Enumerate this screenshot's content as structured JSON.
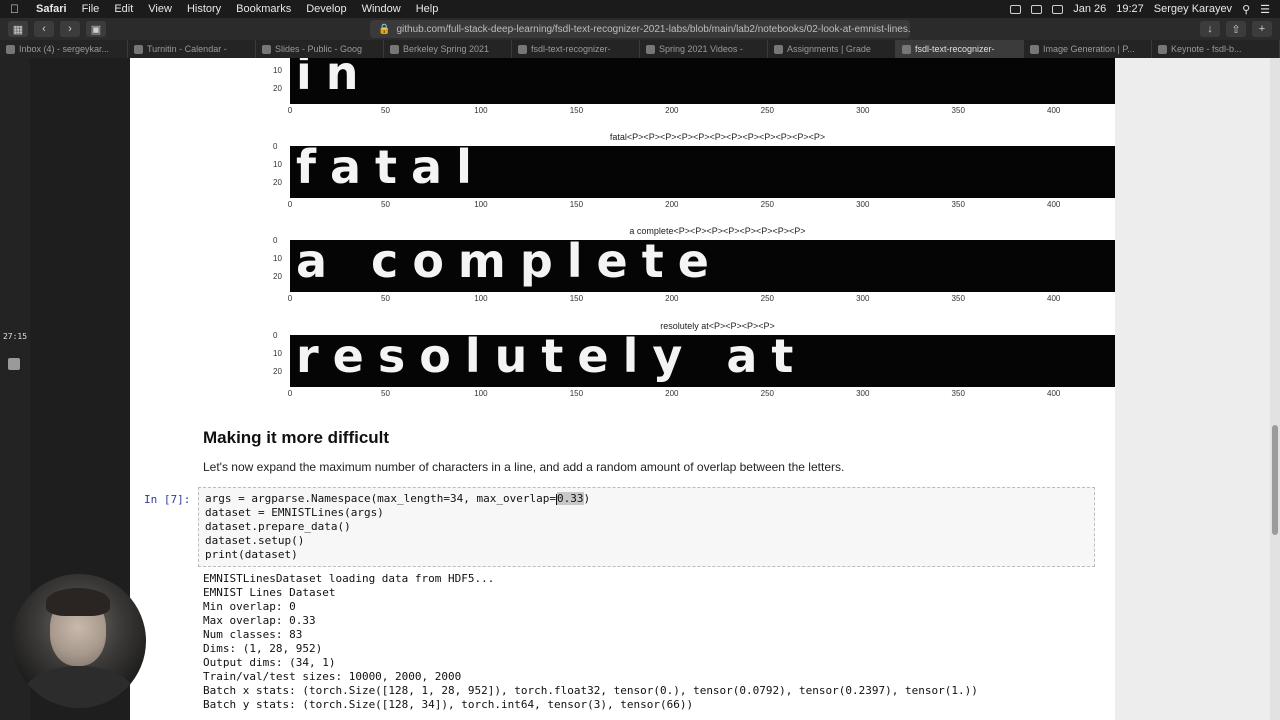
{
  "menubar": {
    "items": [
      "Safari",
      "File",
      "Edit",
      "View",
      "History",
      "Bookmarks",
      "Develop",
      "Window",
      "Help"
    ],
    "date": "Jan 26",
    "time": "19:27",
    "user": "Sergey Karayev"
  },
  "browser": {
    "url": "github.com/full-stack-deep-learning/fsdl-text-recognizer-2021-labs/blob/main/lab2/notebooks/02-look-at-emnist-lines.ipynb",
    "tabs": [
      {
        "label": "Inbox (4) - sergeykar..."
      },
      {
        "label": "Turnitin - Calendar -"
      },
      {
        "label": "Slides - Public - Goog"
      },
      {
        "label": "Berkeley Spring 2021"
      },
      {
        "label": "fsdl-text-recognizer-"
      },
      {
        "label": "Spring 2021 Videos -"
      },
      {
        "label": "Assignments | Grade"
      },
      {
        "label": "fsdl-text-recognizer-",
        "active": true
      },
      {
        "label": "Image Generation | P..."
      },
      {
        "label": "Keynote - fsdl-b..."
      }
    ]
  },
  "recorder": {
    "timer": "27:15"
  },
  "plots": [
    {
      "title": "",
      "text": "in",
      "yticks": [
        "10",
        "20"
      ],
      "xticks": [
        "0",
        "50",
        "100",
        "150",
        "200",
        "250",
        "300",
        "350",
        "400"
      ]
    },
    {
      "title": "fatal<P><P><P><P><P><P><P><P><P><P><P><P>",
      "text": "fatal",
      "yticks": [
        "0",
        "10",
        "20"
      ],
      "xticks": [
        "0",
        "50",
        "100",
        "150",
        "200",
        "250",
        "300",
        "350",
        "400"
      ]
    },
    {
      "title": "a complete<P><P><P><P><P><P><P><P>",
      "text": "a complete",
      "yticks": [
        "0",
        "10",
        "20"
      ],
      "xticks": [
        "0",
        "50",
        "100",
        "150",
        "200",
        "250",
        "300",
        "350",
        "400"
      ]
    },
    {
      "title": "resolutely at<P><P><P><P>",
      "text": "resolutely at",
      "yticks": [
        "0",
        "10",
        "20"
      ],
      "xticks": [
        "0",
        "50",
        "100",
        "150",
        "200",
        "250",
        "300",
        "350",
        "400"
      ]
    }
  ],
  "section": {
    "heading": "Making it more difficult",
    "paragraph": "Let's now expand the maximum number of characters in a line, and add a random amount of overlap between the letters."
  },
  "cell": {
    "prompt": "In [7]:",
    "line1_pre": "args = argparse.Namespace(max_length=34, max_overlap=",
    "line1_sel": "0.33",
    "line1_post": ")",
    "lines": [
      "dataset = EMNISTLines(args)",
      "dataset.prepare_data()",
      "dataset.setup()",
      "print(dataset)"
    ]
  },
  "output": {
    "lines": [
      "EMNISTLinesDataset loading data from HDF5...",
      "EMNIST Lines Dataset",
      "Min overlap: 0",
      "Max overlap: 0.33",
      "Num classes: 83",
      "Dims: (1, 28, 952)",
      "Output dims: (34, 1)",
      "Train/val/test sizes: 10000, 2000, 2000",
      "Batch x stats: (torch.Size([128, 1, 28, 952]), torch.float32, tensor(0.), tensor(0.0792), tensor(0.2397), tensor(1.))",
      "Batch y stats: (torch.Size([128, 34]), torch.int64, tensor(3), tensor(66))"
    ]
  }
}
